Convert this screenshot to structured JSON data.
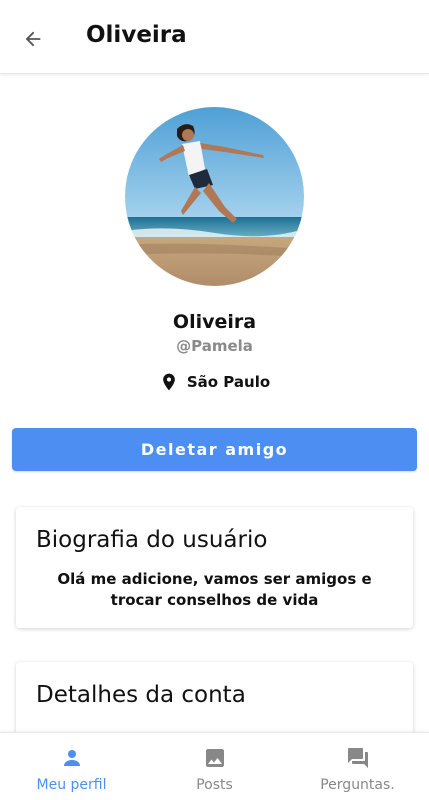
{
  "header": {
    "title": "Oliveira"
  },
  "profile": {
    "name": "Oliveira",
    "handle": "@Pamela",
    "location": "São Paulo"
  },
  "actions": {
    "delete_label": "Deletar amigo"
  },
  "bio_card": {
    "title": "Biografia do usuário",
    "text": "Olá me adicione, vamos ser amigos e trocar conselhos de vida"
  },
  "details_card": {
    "title": "Detalhes da conta"
  },
  "bottom_nav": {
    "items": [
      {
        "label": "Meu perfil",
        "icon": "person-icon",
        "active": true
      },
      {
        "label": "Posts",
        "icon": "image-icon",
        "active": false
      },
      {
        "label": "Perguntas.",
        "icon": "forum-icon",
        "active": false
      }
    ]
  },
  "colors": {
    "accent": "#4d8ef3",
    "inactive": "#888888"
  }
}
